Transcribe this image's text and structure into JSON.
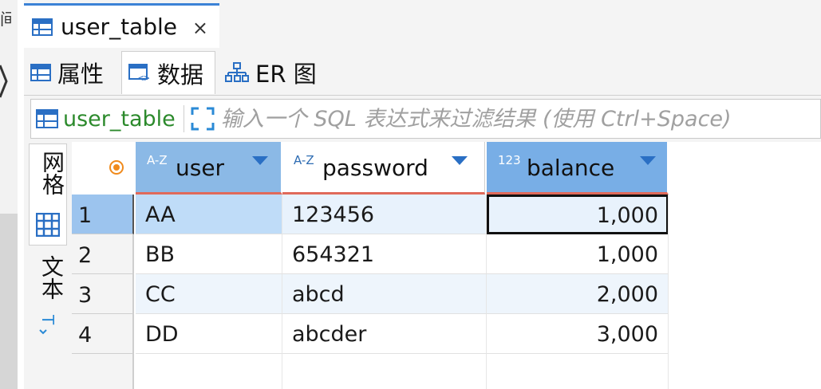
{
  "editor": {
    "tab_title": "user_table",
    "close_glyph": "×"
  },
  "sub_tabs": [
    {
      "label": "属性",
      "icon": "table-icon"
    },
    {
      "label": "数据",
      "icon": "data-icon",
      "active": true
    },
    {
      "label": "ER 图",
      "icon": "er-diagram-icon"
    }
  ],
  "filter": {
    "table_name": "user_table",
    "placeholder": "输入一个 SQL 表达式来过滤结果 (使用 Ctrl+Space)"
  },
  "side_tabs": {
    "grid_label": "网格",
    "text_label": "文本"
  },
  "grid": {
    "columns": [
      {
        "type": "A-Z",
        "name": "user"
      },
      {
        "type": "A-Z",
        "name": "password"
      },
      {
        "type": "123",
        "name": "balance"
      }
    ],
    "rows": [
      {
        "num": "1",
        "user": "AA",
        "password": "123456",
        "balance": "1,000"
      },
      {
        "num": "2",
        "user": "BB",
        "password": "654321",
        "balance": "1,000"
      },
      {
        "num": "3",
        "user": "CC",
        "password": "abcd",
        "balance": "2,000"
      },
      {
        "num": "4",
        "user": "DD",
        "password": "abcder",
        "balance": "3,000"
      }
    ]
  },
  "colors": {
    "accent": "#3c82d6",
    "header_bg": "#8bb9e6",
    "selected_row": "#9cc4ee",
    "filter_green": "#2c8a2c"
  }
}
